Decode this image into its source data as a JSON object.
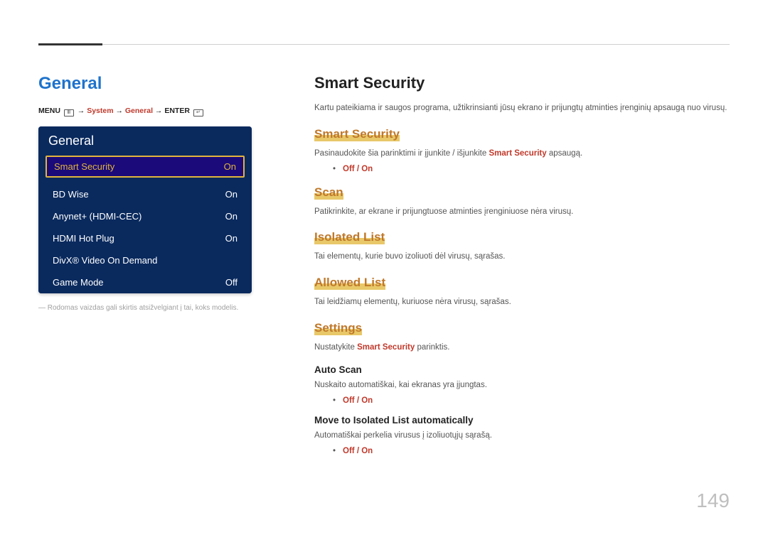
{
  "page_number": "149",
  "left": {
    "title": "General",
    "breadcrumb": {
      "menu": "MENU",
      "arrow": "→",
      "system": "System",
      "general": "General",
      "enter": "ENTER"
    },
    "osd": {
      "title": "General",
      "selected": {
        "label": "Smart Security",
        "value": "On"
      },
      "items": [
        {
          "label": "BD Wise",
          "value": "On"
        },
        {
          "label": "Anynet+ (HDMI-CEC)",
          "value": "On"
        },
        {
          "label": "HDMI Hot Plug",
          "value": "On"
        },
        {
          "label": "DivX® Video On Demand",
          "value": ""
        },
        {
          "label": "Game Mode",
          "value": "Off"
        }
      ]
    },
    "footnote": "―  Rodomas vaizdas gali skirtis atsižvelgiant į tai, koks modelis."
  },
  "right": {
    "title": "Smart Security",
    "intro": "Kartu pateikiama ir saugos programa, užtikrinsianti jūsų ekrano ir prijungtų atminties įrenginių apsaugą nuo virusų.",
    "sections": [
      {
        "heading": "Smart Security",
        "desc_pre": "Pasinaudokite šia parinktimi ir įjunkite / išjunkite ",
        "desc_red": "Smart Security",
        "desc_post": " apsaugą.",
        "options": "Off / On"
      },
      {
        "heading": "Scan",
        "desc": "Patikrinkite, ar ekrane ir prijungtuose atminties įrenginiuose nėra virusų."
      },
      {
        "heading": "Isolated List",
        "desc": "Tai elementų, kurie buvo izoliuoti dėl virusų, sąrašas."
      },
      {
        "heading": "Allowed List",
        "desc": "Tai leidžiamų elementų, kuriuose nėra virusų, sąrašas."
      },
      {
        "heading": "Settings",
        "desc_pre": "Nustatykite ",
        "desc_red": "Smart Security",
        "desc_post": " parinktis.",
        "subs": [
          {
            "title": "Auto Scan",
            "desc": "Nuskaito automatiškai, kai ekranas yra įjungtas.",
            "options": "Off / On"
          },
          {
            "title": "Move to Isolated List automatically",
            "desc": "Automatiškai perkelia virusus į izoliuotųjų sąrašą.",
            "options": "Off / On"
          }
        ]
      }
    ]
  }
}
